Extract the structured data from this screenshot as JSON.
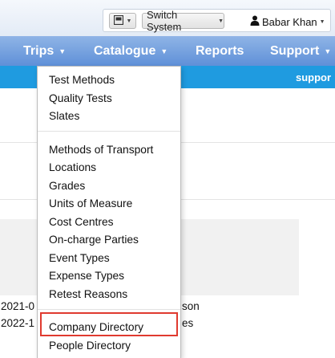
{
  "header": {
    "switch_system_label": "Switch System",
    "user_name": "Babar Khan"
  },
  "nav": {
    "items": [
      "Trips",
      "Catalogue",
      "Reports",
      "Support"
    ]
  },
  "strip": {
    "text": "suppor"
  },
  "background_rows": [
    {
      "date": "2021-0",
      "suffix": "son"
    },
    {
      "date": "2022-1",
      "suffix": "es"
    }
  ],
  "dropdown": {
    "group1": [
      "Test Methods",
      "Quality Tests",
      "Slates"
    ],
    "group2": [
      "Methods of Transport",
      "Locations",
      "Grades",
      "Units of Measure",
      "Cost Centres",
      "On-charge Parties",
      "Event Types",
      "Expense Types",
      "Retest Reasons"
    ],
    "group3": [
      "Company Directory",
      "People Directory"
    ]
  },
  "colors": {
    "nav_bg": "#6f9fdf",
    "strip_bg": "#1f9be0",
    "highlight": "#e03a2f"
  },
  "icons": {
    "layout": "layout-icon",
    "user": "user-icon",
    "caret": "caret-down-icon"
  }
}
